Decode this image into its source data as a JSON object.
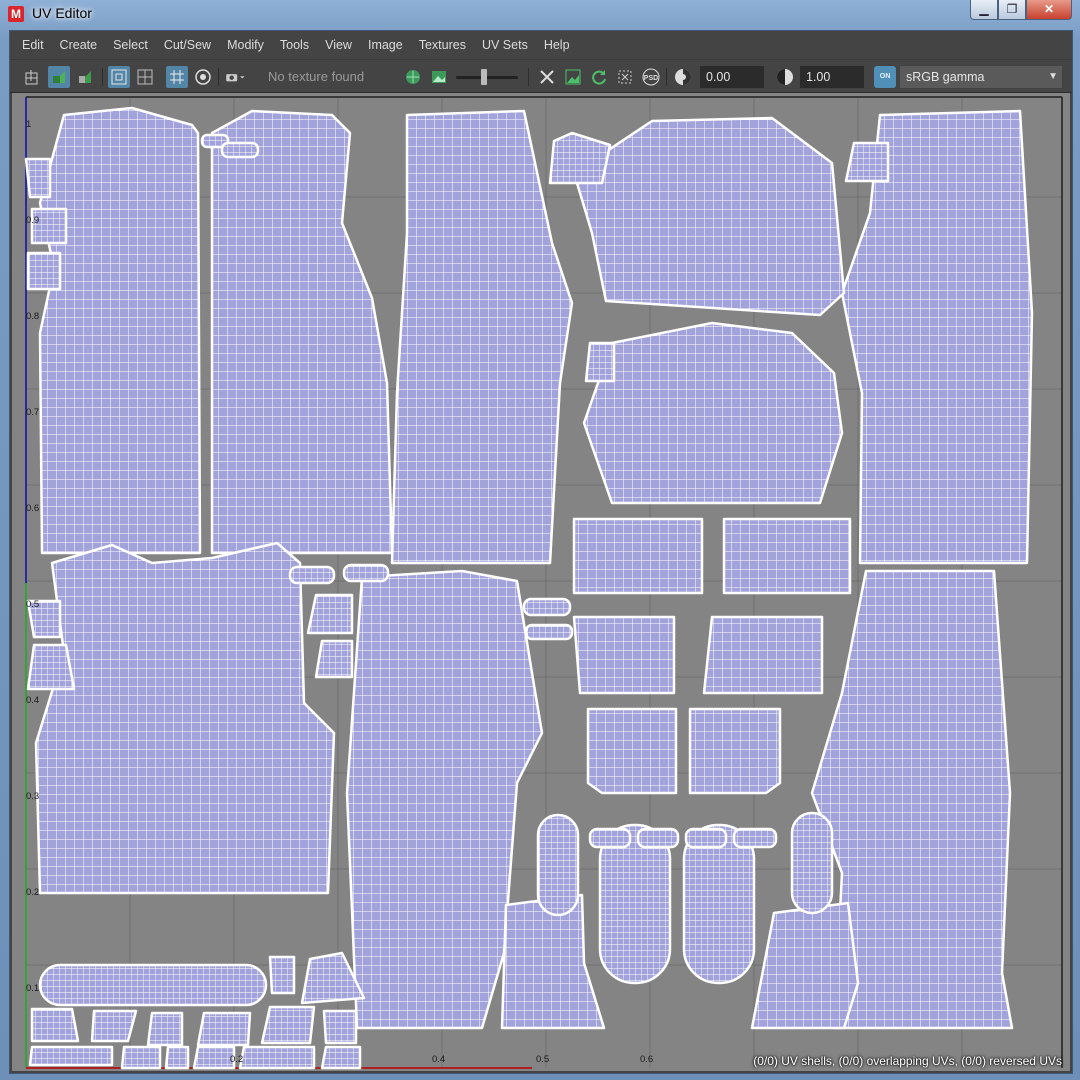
{
  "window": {
    "title": "UV Editor",
    "logo_letter": "M",
    "min_glyph": "▁",
    "max_glyph": "❐",
    "close_glyph": "✕"
  },
  "menu": [
    "Edit",
    "Create",
    "Select",
    "Cut/Sew",
    "Modify",
    "Tools",
    "View",
    "Image",
    "Textures",
    "UV Sets",
    "Help"
  ],
  "toolbar": {
    "texture_placeholder": "No texture found",
    "exposure": "0.00",
    "gamma": "1.00",
    "color_space_badge": "ON",
    "color_space": "sRGB gamma",
    "slider_level": 0.45
  },
  "axis": {
    "v_labels": [
      "1",
      "0.9",
      "0.8",
      "0.7",
      "0.6",
      "0.5",
      "0.4",
      "0.3",
      "0.2",
      "0.1"
    ],
    "u_labels": [
      "0.2",
      "0.4",
      "0.5",
      "0.6"
    ]
  },
  "status": "(0/0) UV shells, (0/0) overlapping UVs, (0/0) reversed UVs",
  "colors": {
    "uv_fill": "#a3a3dc",
    "uv_wire": "#ffffff",
    "grid_background": "#848484",
    "v_axis": "#2a2aa0",
    "u_axis_start": "#38a238"
  }
}
